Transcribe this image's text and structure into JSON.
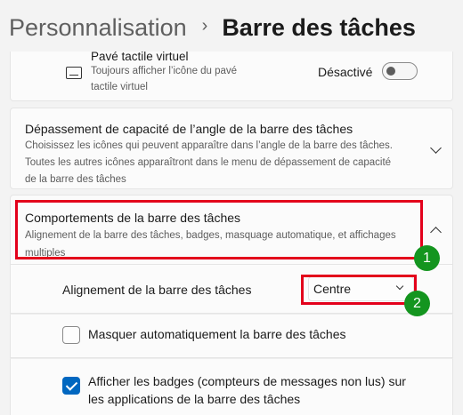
{
  "header": {
    "parent": "Personnalisation",
    "separator": "›",
    "current": "Barre des tâches"
  },
  "touchpad_keyboard": {
    "title": "Pavé tactile virtuel",
    "description_line1": "Toujours afficher l’icône du pavé",
    "description_line2": "tactile virtuel",
    "toggle_label": "Désactivé",
    "toggle_on": false,
    "icon": "keyboard-icon"
  },
  "corner_overflow": {
    "title": "Dépassement de capacité de l’angle de la barre des tâches",
    "description_line1": "Choisissez les icônes qui peuvent apparaître dans l’angle de la barre des tâches.",
    "description_line2": "Toutes les autres icônes apparaîtront dans le menu de dépassement de capacité",
    "description_line3": "de la barre des tâches",
    "icon": "chevron-down-icon"
  },
  "behaviors": {
    "title": "Comportements de la barre des tâches",
    "description_line1": "Alignement de la barre des tâches, badges, masquage automatique, et affichages",
    "description_line2": "multiples",
    "icon": "chevron-up-icon",
    "alignment": {
      "label": "Alignement de la barre des tâches",
      "selected": "Centre"
    },
    "autohide": {
      "label": "Masquer automatiquement la barre des tâches",
      "checked": false
    },
    "badges": {
      "label_line1": "Afficher les badges (compteurs de messages non lus) sur",
      "label_line2": "les applications de la barre des tâches",
      "checked": true
    }
  },
  "callouts": {
    "one": "1",
    "two": "2",
    "box_color": "#e3001b",
    "badge_color": "#14951f"
  },
  "colors": {
    "accent": "#0067c0",
    "background": "#f3f3f3"
  }
}
